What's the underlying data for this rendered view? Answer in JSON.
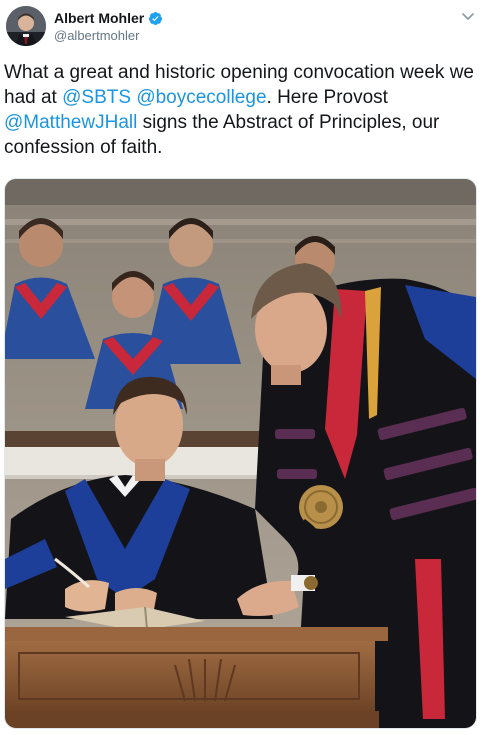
{
  "author": {
    "display_name": "Albert Mohler",
    "handle": "@albertmohler",
    "verified": true,
    "avatar_icon": "profile-photo"
  },
  "tweet": {
    "text_1": "What a great and historic opening convocation week we had at ",
    "mention_1": "@SBTS",
    "text_2": " ",
    "mention_2": "@boycecollege",
    "text_3": ". Here Provost ",
    "mention_3": "@MatthewJHall",
    "text_4": " signs the Abstract of Principles, our confession of faith."
  },
  "menu_icon": "chevron-down-icon",
  "photo": {
    "subject": "Provost signing the Abstract of Principles at convocation",
    "colors": {
      "robe_black": "#141418",
      "hood_blue": "#1d3f9a",
      "choir_blue": "#2a4f9c",
      "choir_red": "#c8283a",
      "desk_wood": "#8a5a36",
      "medal_gold": "#b8904a",
      "stripe_purple": "#5a2e52"
    }
  },
  "colors": {
    "link": "#1b95e0",
    "text": "#14171a",
    "secondary": "#657786",
    "verified_badge": "#1da1f2"
  }
}
